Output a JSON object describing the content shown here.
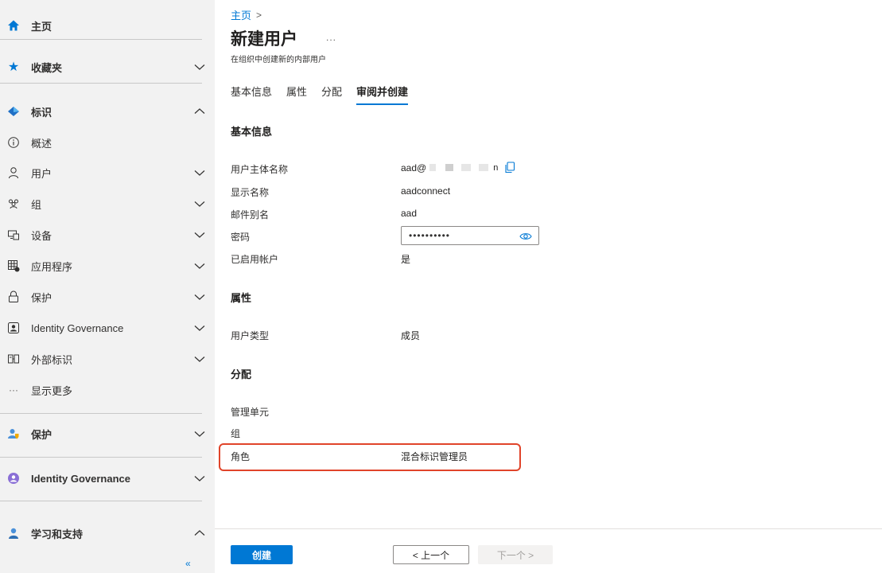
{
  "sidebar": {
    "home": "主页",
    "favorites": "收藏夹",
    "identity": "标识",
    "overview": "概述",
    "users": "用户",
    "groups": "组",
    "devices": "设备",
    "applications": "应用程序",
    "protection": "保护",
    "identity_governance": "Identity Governance",
    "external_identities": "外部标识",
    "show_more": "显示更多",
    "protection_section": "保护",
    "identity_governance_section": "Identity Governance",
    "learn_support": "学习和支持",
    "collapse": "«"
  },
  "breadcrumb": {
    "home": "主页",
    "separator": ">"
  },
  "page": {
    "title": "新建用户",
    "more": "...",
    "subtitle": "在组织中创建新的内部用户"
  },
  "tabs": [
    "基本信息",
    "属性",
    "分配",
    "审阅并创建"
  ],
  "basics": {
    "title": "基本信息",
    "upn_label": "用户主体名称",
    "upn_value_start": "aad@",
    "upn_value_end": "n",
    "display_name_label": "显示名称",
    "display_name_value": "aadconnect",
    "mail_nickname_label": "邮件别名",
    "mail_nickname_value": "aad",
    "password_label": "密码",
    "password_value": "••••••••••",
    "account_enabled_label": "已启用帐户",
    "account_enabled_value": "是"
  },
  "properties": {
    "title": "属性",
    "user_type_label": "用户类型",
    "user_type_value": "成员"
  },
  "assignments": {
    "title": "分配",
    "admin_units_label": "管理单元",
    "groups_label": "组",
    "roles_label": "角色",
    "roles_value": "混合标识管理员"
  },
  "footer": {
    "create": "创建",
    "previous": "< 上一个",
    "next": "下一个 >"
  },
  "colors": {
    "accent": "#0078d4",
    "highlight": "#e0442a"
  }
}
